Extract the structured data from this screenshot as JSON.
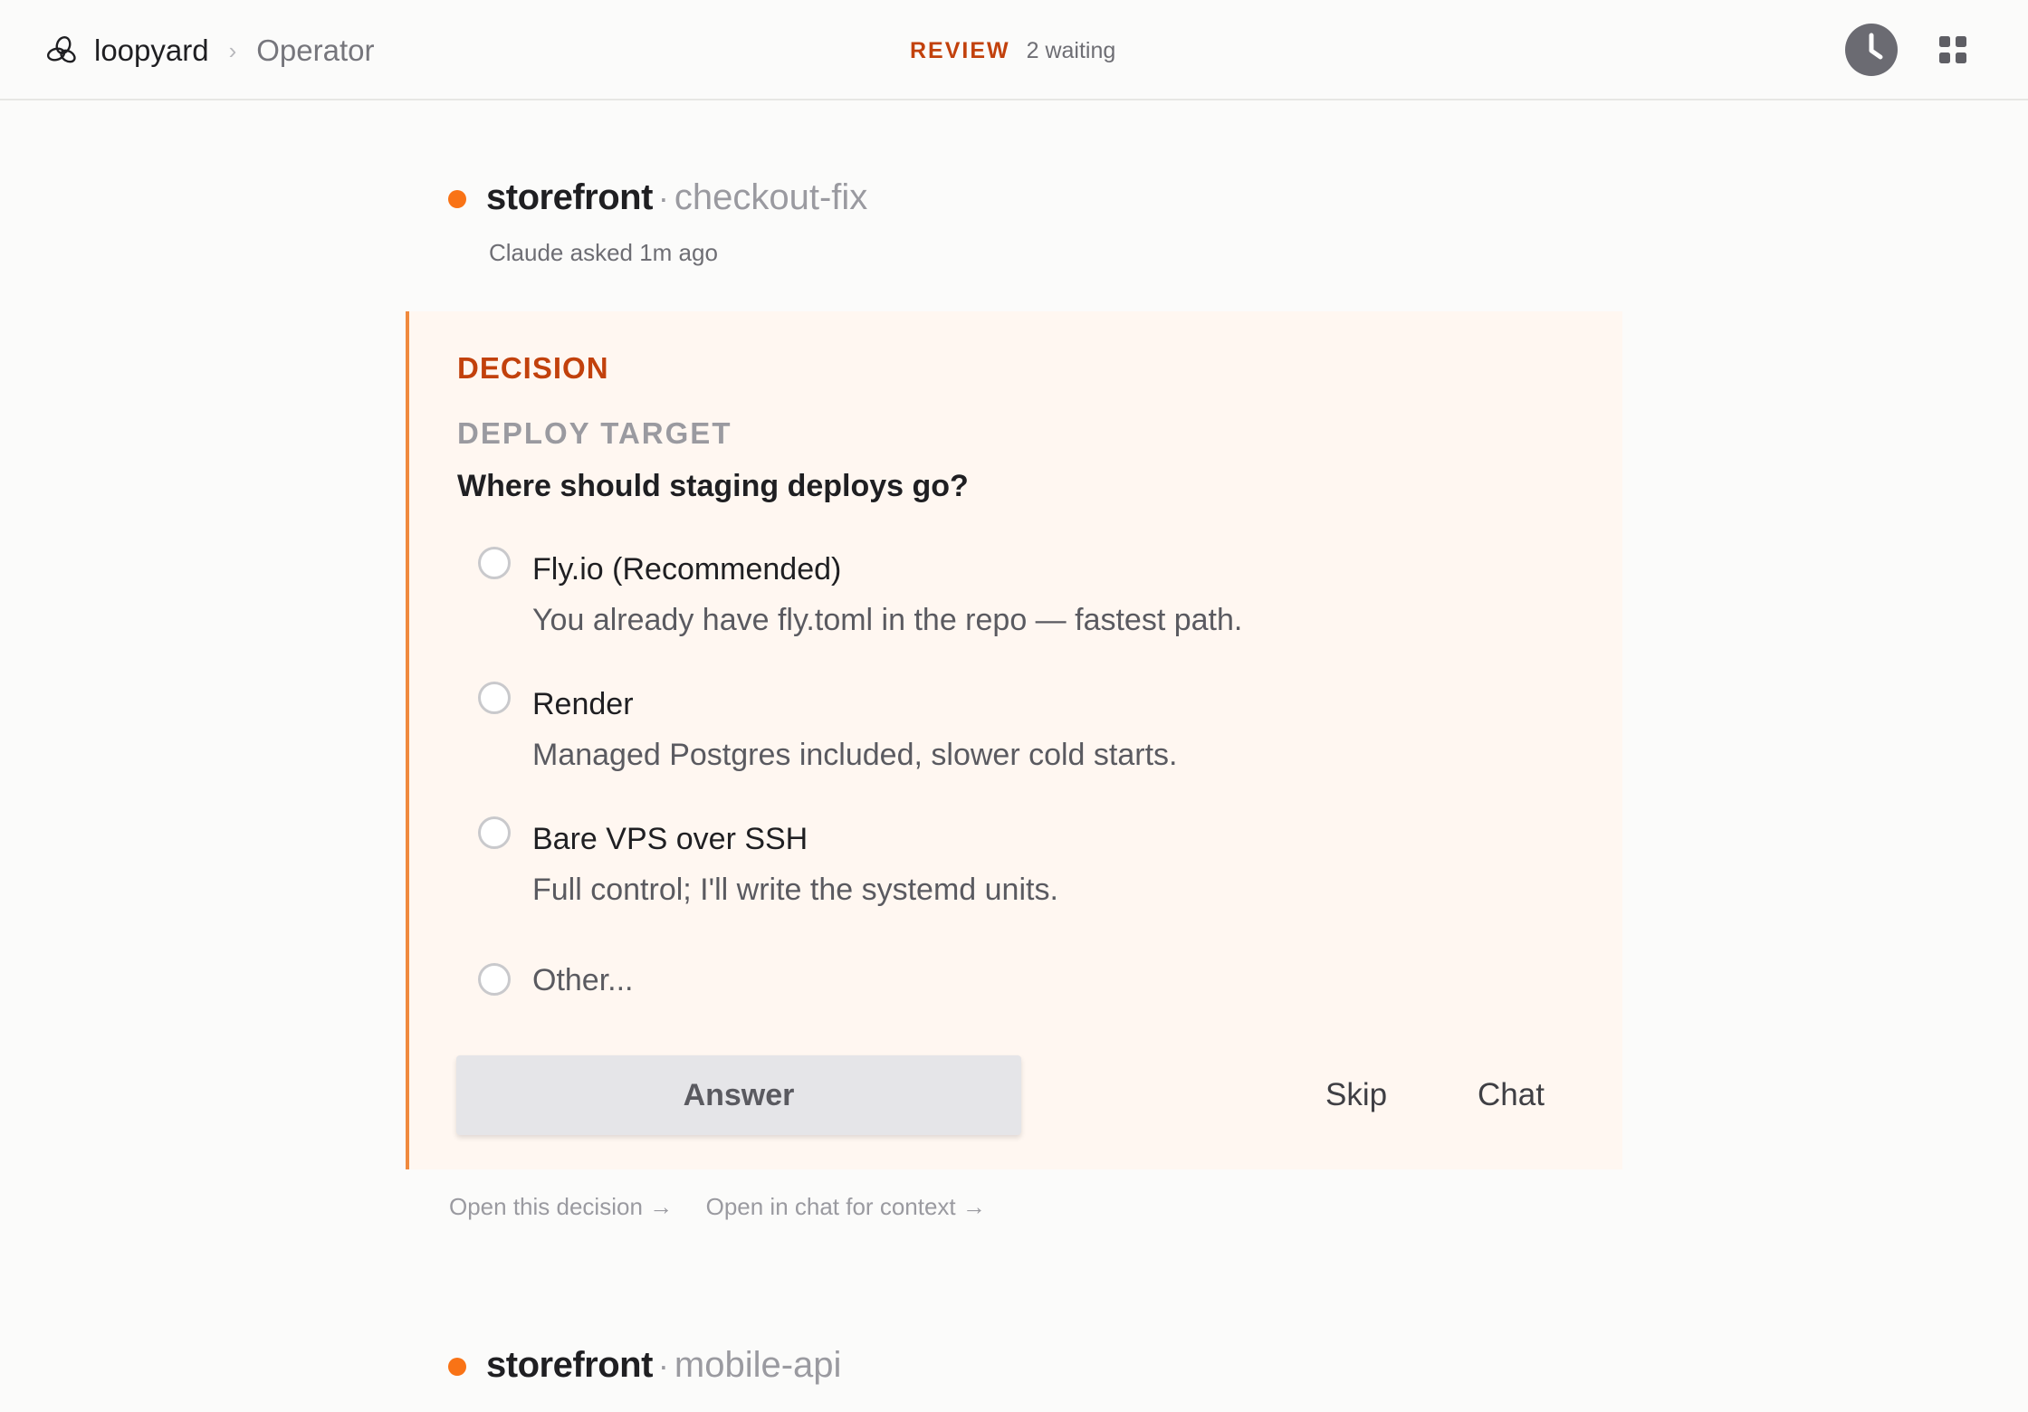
{
  "app": {
    "brand": "loopyard",
    "breadcrumb_separator": "›",
    "page": "Operator"
  },
  "header": {
    "review_label": "REVIEW",
    "review_count": "2 waiting",
    "history_icon": "clock-icon",
    "apps_icon": "grid-icon"
  },
  "colors": {
    "accent": "#c2410c",
    "status_dot": "#f97316",
    "card_border": "#f08a3e",
    "card_bg": "#fff7f1"
  },
  "items": [
    {
      "repo": "storefront",
      "separator": "·",
      "branch": "checkout-fix",
      "asked": "Claude asked 1m ago",
      "decision": {
        "label": "DECISION",
        "topic": "DEPLOY TARGET",
        "question": "Where should staging deploys go?",
        "options": [
          {
            "title": "Fly.io (Recommended)",
            "description": "You already have fly.toml in the repo — fastest path."
          },
          {
            "title": "Render",
            "description": "Managed Postgres included, slower cold starts."
          },
          {
            "title": "Bare VPS over SSH",
            "description": "Full control; I'll write the systemd units."
          }
        ],
        "other_label": "Other...",
        "answer_label": "Answer",
        "skip_label": "Skip",
        "chat_label": "Chat"
      },
      "links": {
        "open_decision": "Open this decision →",
        "open_chat": "Open in chat for context →"
      }
    },
    {
      "repo": "storefront",
      "separator": "·",
      "branch": "mobile-api"
    }
  ]
}
